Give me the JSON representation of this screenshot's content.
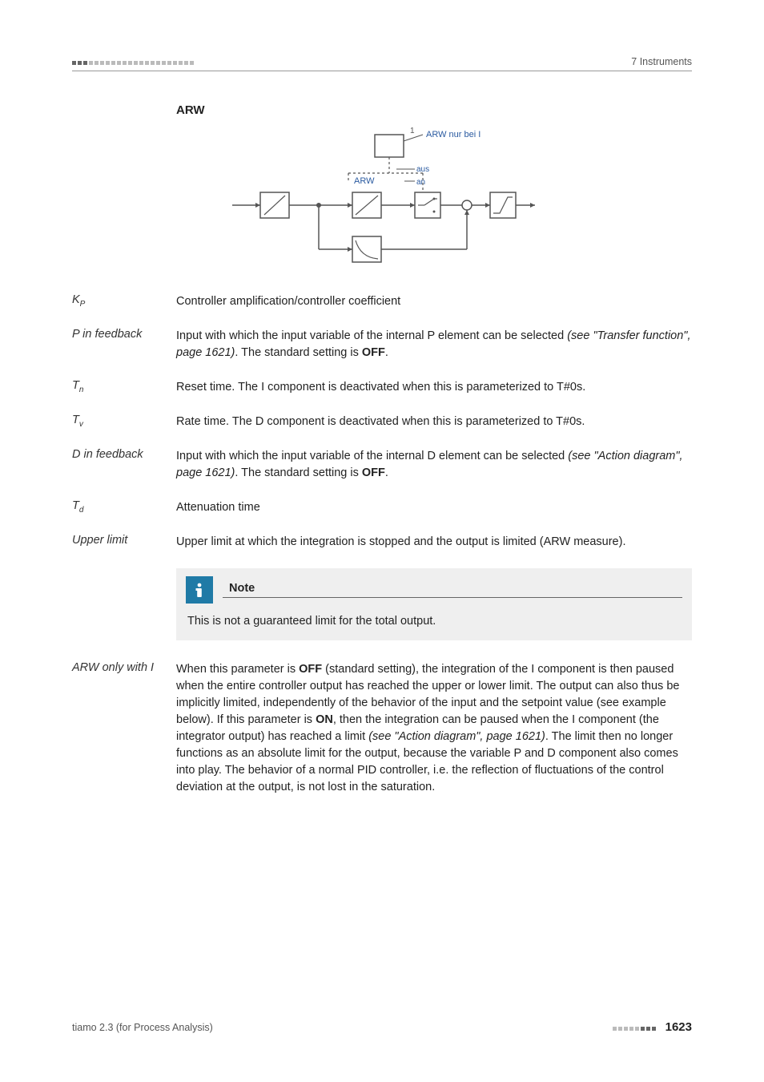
{
  "header": {
    "chapter": "7 Instruments"
  },
  "section_heading": "ARW",
  "diagram": {
    "label_top": "ARW nur bei I",
    "label_arw": "ARW",
    "label_aus": "aus",
    "label_an": "an"
  },
  "params": [
    {
      "label_html": "K<sub>P</sub>",
      "body_html": "Controller amplification/controller coefficient"
    },
    {
      "label_html": "P in feedback",
      "body_html": "Input with which the input variable of the internal P element can be selected <span class=\"ital\">(see \"Transfer function\", page 1621)</span>. The standard setting is <strong>OFF</strong>."
    },
    {
      "label_html": "T<sub>n</sub>",
      "body_html": "Reset time. The I component is deactivated when this is parameterized to T#0s."
    },
    {
      "label_html": "T<sub>v</sub>",
      "body_html": "Rate time. The D component is deactivated when this is parameterized to T#0s."
    },
    {
      "label_html": "D in feedback",
      "body_html": "Input with which the input variable of the internal D element can be selected <span class=\"ital\">(see \"Action diagram\", page 1621)</span>. The standard setting is <strong>OFF</strong>."
    },
    {
      "label_html": "T<sub>d</sub>",
      "body_html": "Attenuation time"
    },
    {
      "label_html": "Upper limit",
      "body_html": "Upper limit at which the integration is stopped and the output is limited (ARW measure)."
    }
  ],
  "note": {
    "title": "Note",
    "body": "This is not a guaranteed limit for the total output."
  },
  "param_after_note": {
    "label_html": "ARW only with I",
    "body_html": "When this parameter is <strong>OFF</strong> (standard setting), the integration of the I component is then paused when the entire controller output has reached the upper or lower limit. The output can also thus be implicitly limited, independently of the behavior of the input and the setpoint value (see example below). If this parameter is <strong>ON</strong>, then the integration can be paused when the I component (the integrator output) has reached a limit <span class=\"ital\">(see \"Action diagram\", page 1621)</span>. The limit then no longer functions as an absolute limit for the output, because the variable P and D component also comes into play. The behavior of a normal PID controller, i.e. the reflection of fluctuations of the control deviation at the output, is not lost in the saturation."
  },
  "footer": {
    "left": "tiamo 2.3 (for Process Analysis)",
    "page": "1623"
  }
}
